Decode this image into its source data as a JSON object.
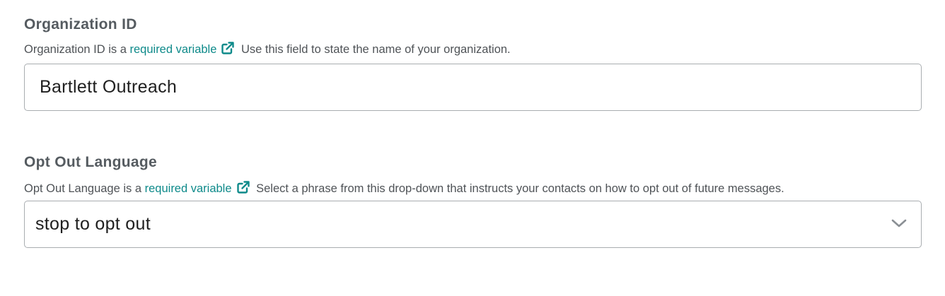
{
  "organization_id": {
    "title": "Organization ID",
    "help_prefix": "Organization ID is a",
    "help_link": "required variable",
    "help_suffix": "Use this field to state the name of your organization.",
    "value": "Bartlett Outreach"
  },
  "opt_out_language": {
    "title": "Opt Out Language",
    "help_prefix": "Opt Out Language is a",
    "help_link": "required variable",
    "help_suffix": "Select a phrase from this drop-down that instructs your contacts on how to opt out of future messages.",
    "selected_value": "stop to opt out"
  },
  "colors": {
    "link": "#0e8a8a",
    "border": "#a9adb0",
    "title": "#555b60"
  },
  "icons": {
    "external_link": "external-link-icon",
    "dropdown": "chevron-down-icon"
  }
}
